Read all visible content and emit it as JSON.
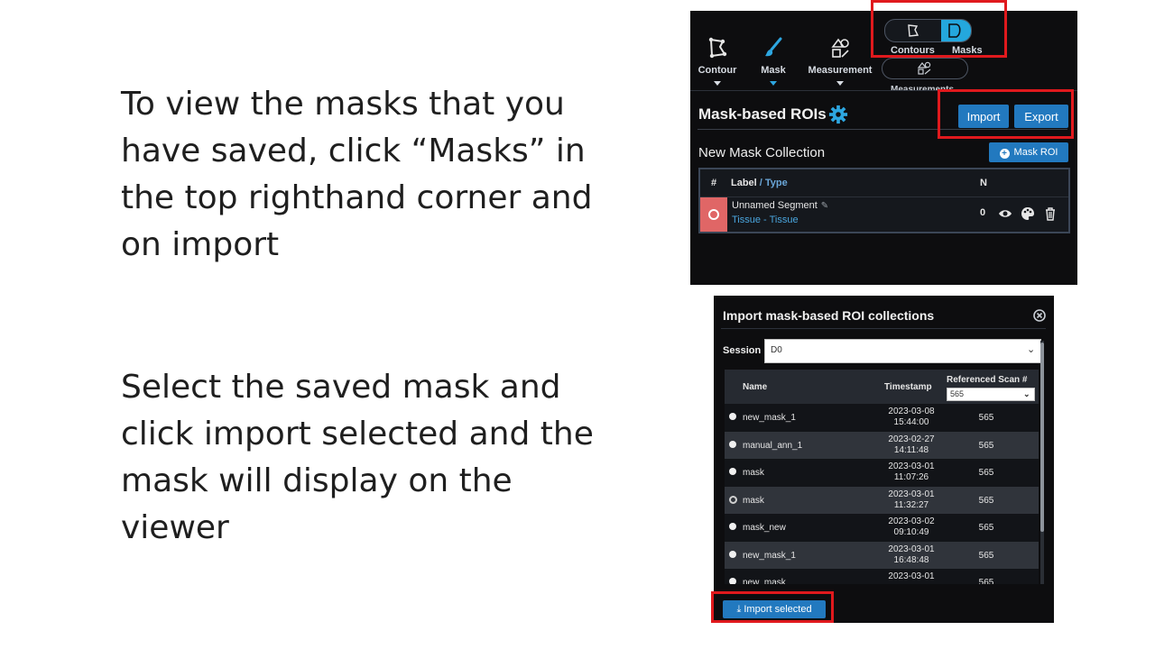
{
  "instructions": {
    "text1": "To view the masks that you have saved, click “Masks” in the top righthand corner and on import",
    "text2": "Select the saved mask and click import selected and the mask will display on the viewer"
  },
  "toolbar": {
    "top_strip": "",
    "tools": [
      {
        "label": "Contour",
        "icon": "polygon-contour-icon"
      },
      {
        "label": "Mask",
        "icon": "brush-icon"
      },
      {
        "label": "Measurement",
        "icon": "measurement-icon"
      }
    ],
    "toggle": {
      "contours_label": "Contours",
      "masks_label": "Masks",
      "active": "Masks"
    },
    "measurement_sublabel": "Measurements"
  },
  "mask_rois": {
    "title": "Mask-based ROIs",
    "import_label": "Import",
    "export_label": "Export",
    "collection_name": "New Mask Collection",
    "add_button_label": "Mask ROI",
    "table": {
      "col_hash": "#",
      "col_label": "Label",
      "col_type": "/ Type",
      "col_n": "N",
      "rows": [
        {
          "name": "Unnamed Segment",
          "type": "Tissue - Tissue",
          "n": "0",
          "color": "#e06666"
        }
      ]
    }
  },
  "import_dialog": {
    "title": "Import mask-based ROI collections",
    "session_label": "Session",
    "session_value": "D0",
    "columns": {
      "name": "Name",
      "timestamp": "Timestamp",
      "ref_scan": "Referenced Scan #"
    },
    "ref_scan_filter": "565",
    "rows": [
      {
        "name": "new_mask_1",
        "date": "2023-03-08",
        "time": "15:44:00",
        "ref": "565",
        "selected": false
      },
      {
        "name": "manual_ann_1",
        "date": "2023-02-27",
        "time": "14:11:48",
        "ref": "565",
        "selected": false
      },
      {
        "name": "mask",
        "date": "2023-03-01",
        "time": "11:07:26",
        "ref": "565",
        "selected": false
      },
      {
        "name": "mask",
        "date": "2023-03-01",
        "time": "11:32:27",
        "ref": "565",
        "selected": true
      },
      {
        "name": "mask_new",
        "date": "2023-03-02",
        "time": "09:10:49",
        "ref": "565",
        "selected": false
      },
      {
        "name": "new_mask_1",
        "date": "2023-03-01",
        "time": "16:48:48",
        "ref": "565",
        "selected": false
      },
      {
        "name": "new_mask",
        "date": "2023-03-01",
        "time": "",
        "ref": "565",
        "selected": false
      }
    ],
    "import_selected_label": "Import selected"
  },
  "colors": {
    "accent": "#2279bf",
    "highlight": "#e0191d",
    "toggle_active": "#24a7dd"
  }
}
